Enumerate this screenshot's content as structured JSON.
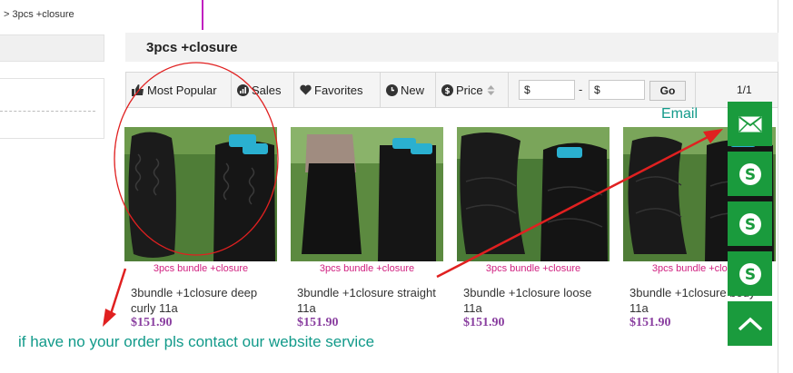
{
  "breadcrumb": "> 3pcs +closure",
  "category": {
    "title": "3pcs +closure"
  },
  "sortbar": {
    "most_popular": "Most Popular",
    "sales": "Sales",
    "favorites": "Favorites",
    "new": "New",
    "price": "Price",
    "min_price": "$",
    "max_price": "$",
    "separator": "-",
    "go": "Go",
    "page": "1/1"
  },
  "products": [
    {
      "caption": "3pcs bundle +closure",
      "name": "3bundle +1closure deep curly 11a",
      "price": "$151.90"
    },
    {
      "caption": "3pcs bundle +closure",
      "name": "3bundle +1closure straight 11a",
      "price": "$151.90"
    },
    {
      "caption": "3pcs bundle +closure",
      "name": "3bundle +1closure loose 11a",
      "price": "$151.90"
    },
    {
      "caption": "3pcs bundle +closure",
      "name": "3bundle +1closure body 11a",
      "price": "$151.90"
    }
  ],
  "side_buttons": [
    "email-icon",
    "skype-icon",
    "skype-icon",
    "skype-icon",
    "back-to-top-icon"
  ],
  "annotations": {
    "email_label": "Email",
    "contact_note": "if have no your order pls contact our website service"
  },
  "colors": {
    "accent_green": "#1a9b3d",
    "annotation_red": "#e02020",
    "annotation_teal": "#129a8a",
    "price_purple": "#8a3fa0",
    "caption_pink": "#d02080"
  }
}
